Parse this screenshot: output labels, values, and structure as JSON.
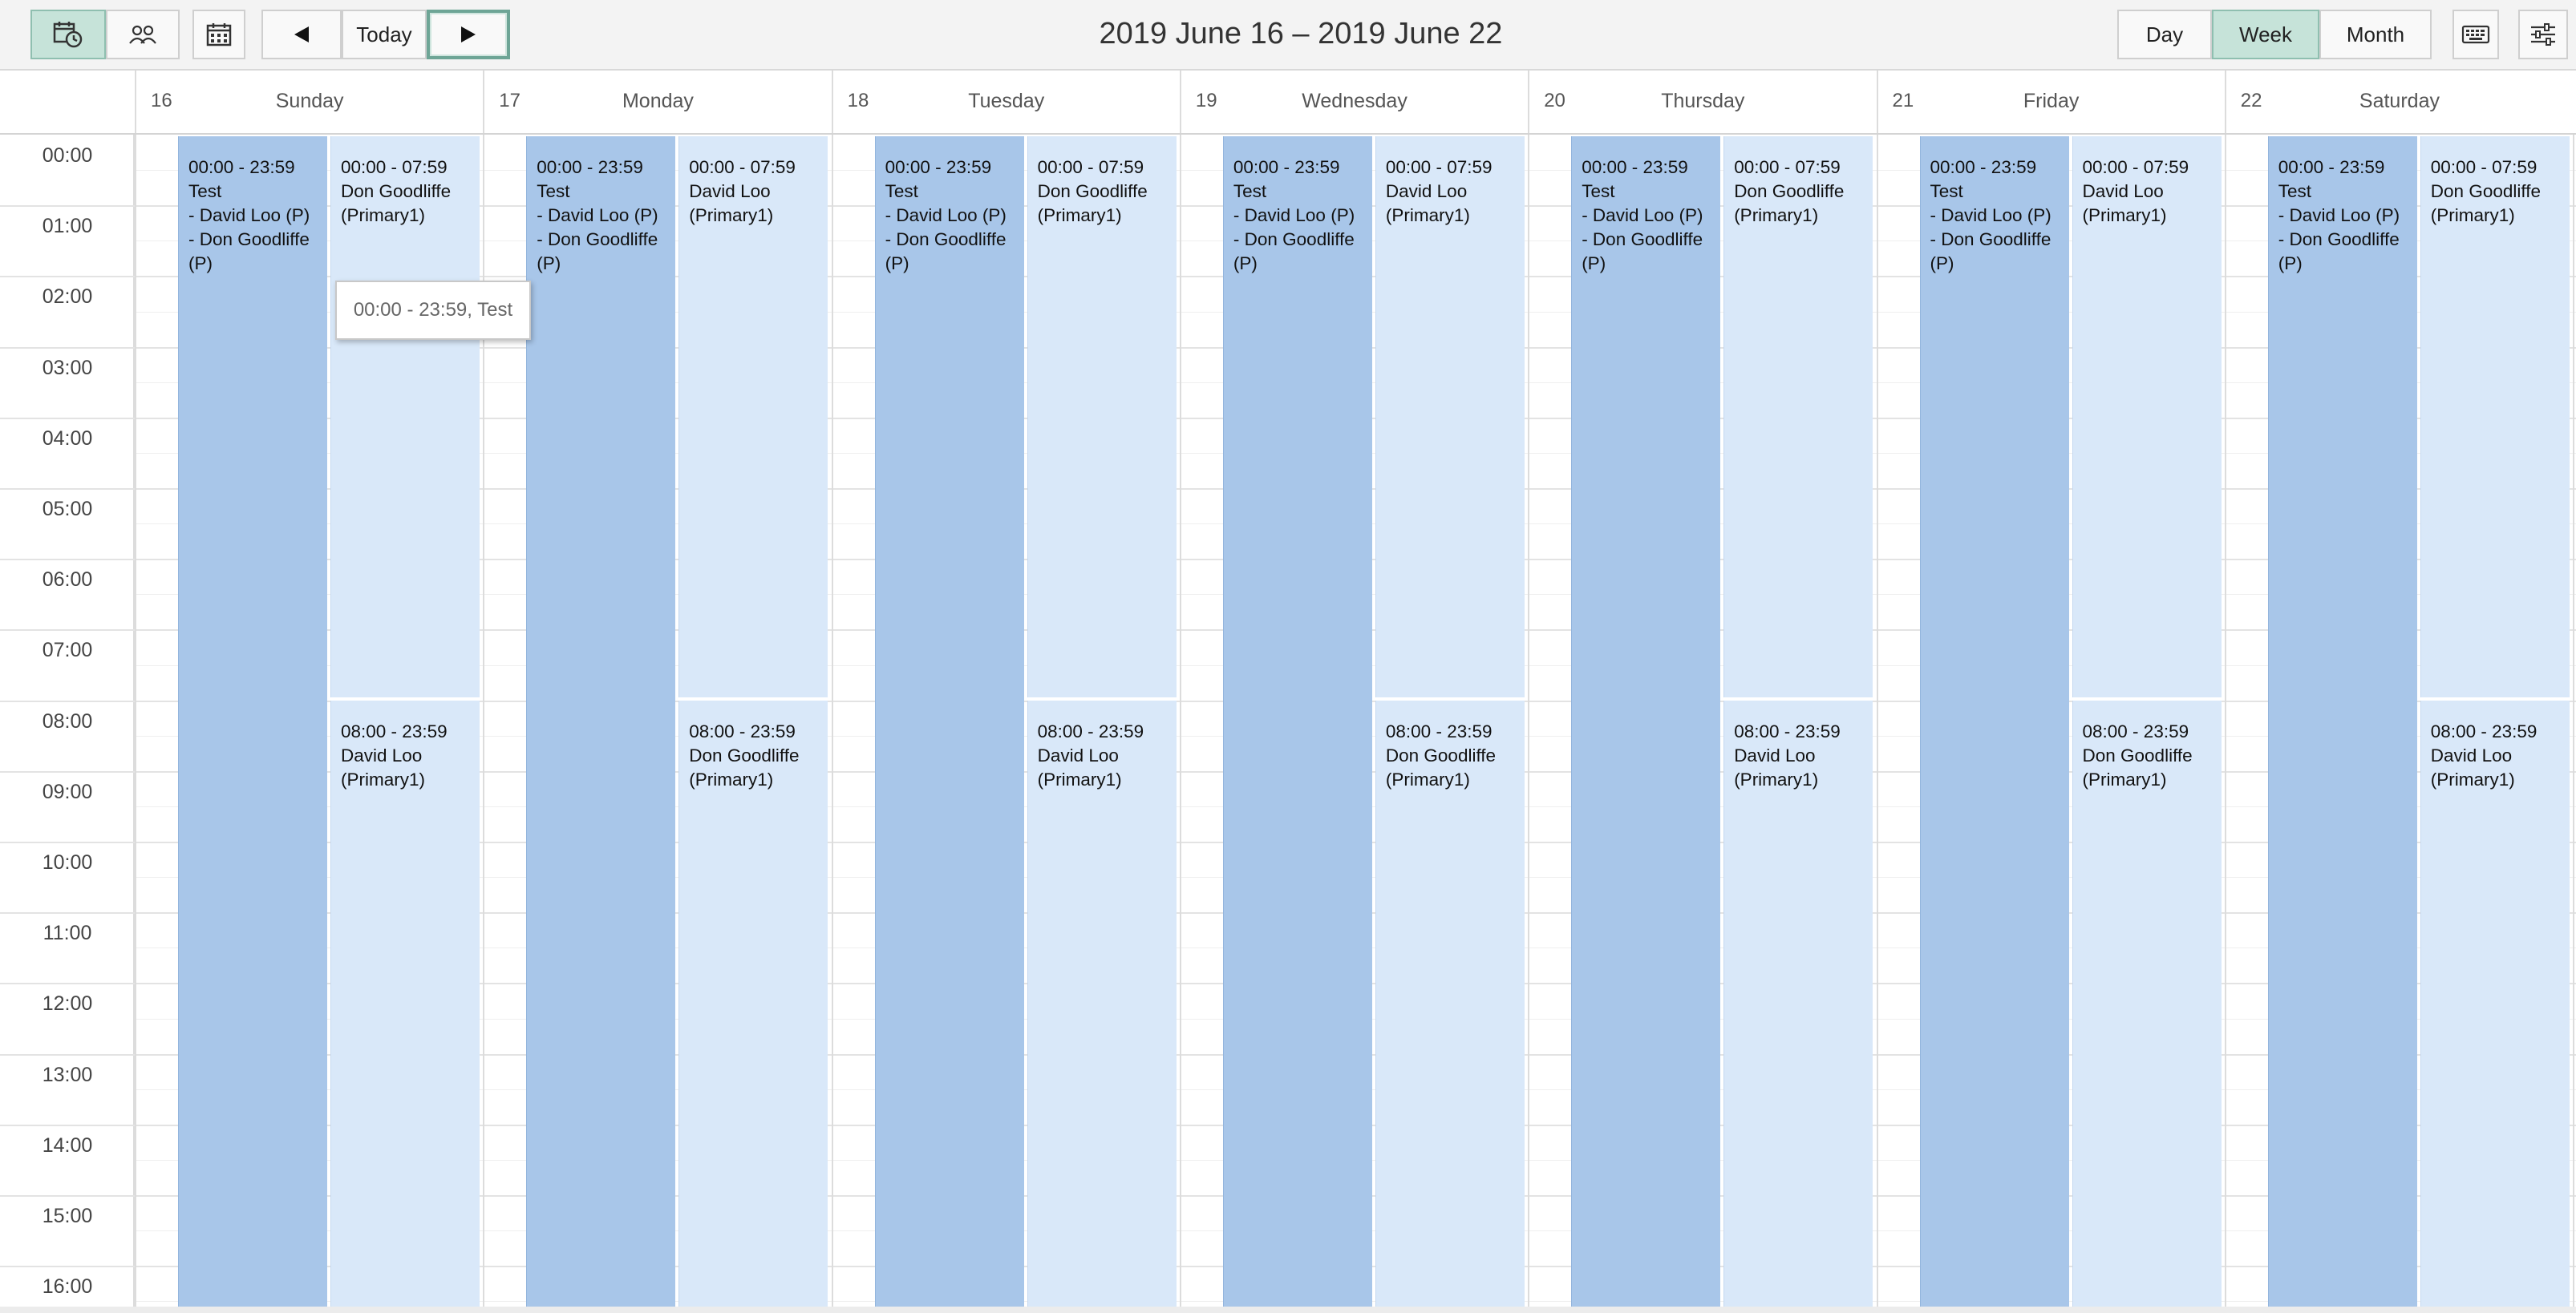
{
  "toolbar": {
    "schedule_view_icon": "calendar-clock-icon",
    "people_view_icon": "users-icon",
    "date_picker_icon": "calendar-grid-icon",
    "prev_icon": "arrow-left-icon",
    "today_label": "Today",
    "next_icon": "arrow-right-icon",
    "title": "2019 June 16 – 2019 June 22",
    "view_day": "Day",
    "view_week": "Week",
    "view_month": "Month",
    "active_view": "Week",
    "keyboard_icon": "keyboard-icon",
    "settings_icon": "sliders-icon"
  },
  "days": [
    {
      "num": "16",
      "name": "Sunday"
    },
    {
      "num": "17",
      "name": "Monday"
    },
    {
      "num": "18",
      "name": "Tuesday"
    },
    {
      "num": "19",
      "name": "Wednesday"
    },
    {
      "num": "20",
      "name": "Thursday"
    },
    {
      "num": "21",
      "name": "Friday"
    },
    {
      "num": "22",
      "name": "Saturday"
    }
  ],
  "hours": [
    "00:00",
    "01:00",
    "02:00",
    "03:00",
    "04:00",
    "05:00",
    "06:00",
    "07:00",
    "08:00",
    "09:00",
    "10:00",
    "11:00",
    "12:00",
    "13:00",
    "14:00",
    "15:00",
    "16:00"
  ],
  "events": {
    "test": [
      "00:00 - 23:59",
      "Test",
      "- David Loo (P)",
      "- Don Goodliffe",
      "(P)"
    ],
    "morning": [
      [
        "00:00 - 07:59",
        "Don Goodliffe",
        "(Primary1)"
      ],
      [
        "00:00 - 07:59",
        "David Loo",
        "(Primary1)"
      ],
      [
        "00:00 - 07:59",
        "Don Goodliffe",
        "(Primary1)"
      ],
      [
        "00:00 - 07:59",
        "David Loo",
        "(Primary1)"
      ],
      [
        "00:00 - 07:59",
        "Don Goodliffe",
        "(Primary1)"
      ],
      [
        "00:00 - 07:59",
        "David Loo",
        "(Primary1)"
      ],
      [
        "00:00 - 07:59",
        "Don Goodliffe",
        "(Primary1)"
      ]
    ],
    "afternoon": [
      [
        "08:00 - 23:59",
        "David Loo",
        "(Primary1)"
      ],
      [
        "08:00 - 23:59",
        "Don Goodliffe",
        "(Primary1)"
      ],
      [
        "08:00 - 23:59",
        "David Loo",
        "(Primary1)"
      ],
      [
        "08:00 - 23:59",
        "Don Goodliffe",
        "(Primary1)"
      ],
      [
        "08:00 - 23:59",
        "David Loo",
        "(Primary1)"
      ],
      [
        "08:00 - 23:59",
        "Don Goodliffe",
        "(Primary1)"
      ],
      [
        "08:00 - 23:59",
        "David Loo",
        "(Primary1)"
      ]
    ]
  },
  "tooltip": "00:00 - 23:59, Test",
  "colors": {
    "test_event": "#a8c6e9",
    "shift_event": "#d9e8f9",
    "active_button": "#c6e3d9"
  }
}
